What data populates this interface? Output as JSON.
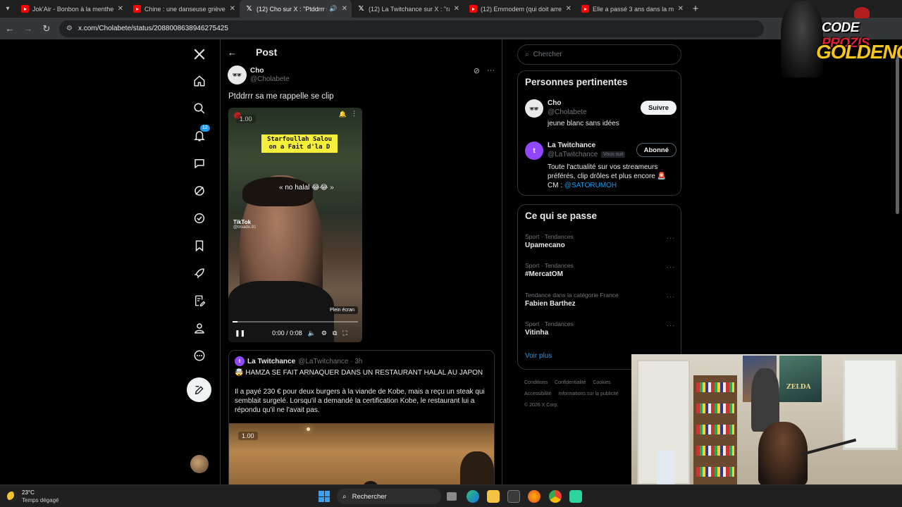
{
  "browser": {
    "tabs": [
      {
        "title": "Jok'Air - Bonbon à la menthe F",
        "type": "youtube",
        "active": false
      },
      {
        "title": "Chine : une danseuse grièveme",
        "type": "youtube",
        "active": false
      },
      {
        "title": "(12) Cho sur X : \"Ptddrrr sa",
        "type": "x",
        "active": true
      },
      {
        "title": "(12) La Twitchance sur X : \"ra Fl",
        "type": "x",
        "active": false
      },
      {
        "title": "(12) Emmodem (qui doit arrete",
        "type": "youtube",
        "active": false
      },
      {
        "title": "Elle a passé 3 ans dans la maiso",
        "type": "youtube",
        "active": false
      }
    ],
    "url": "x.com/Cholabete/status/2088008638946275425"
  },
  "nav": {
    "notification_badge": "12",
    "items": [
      "x-logo-icon",
      "home-icon",
      "search-icon",
      "bell-icon",
      "messages-icon",
      "grok-icon",
      "verified-icon",
      "bookmark-icon",
      "rocket-icon",
      "edit-list-icon",
      "profile-icon",
      "more-icon"
    ]
  },
  "post": {
    "header_title": "Post",
    "author_name": "Cho",
    "author_handle": "@Cholabete",
    "text": "Ptddrrr sa me rappelle se clip",
    "video": {
      "speed": "1.00",
      "caption": "Starfoullah Salou on a Fait d'la D",
      "overlay_text": "« no halal 😂😂 »",
      "tiktok_label": "TikTok",
      "tiktok_user": "@trisado.91",
      "fullscreen_tip": "Plein écran",
      "time": "0:00 / 0:08",
      "progress": 0.0
    },
    "quote": {
      "author_name": "La Twitchance",
      "author_handle": "@LaTwitchance · 3h",
      "title": "🤯 HAMZA SE FAIT ARNAQUER DANS UN RESTAURANT HALAL AU JAPON",
      "body": "Il a payé 230 € pour deux burgers à la viande de Kobe, mais a reçu un steak qui semblait surgelé. Lorsqu'il a demandé la certification Kobe, le restaurant lui a répondu qu'il ne l'avait pas.",
      "media_speed": "1.00"
    }
  },
  "sidebar": {
    "search_placeholder": "Chercher",
    "relevant": {
      "title": "Personnes pertinentes",
      "people": [
        {
          "name": "Cho",
          "handle": "@Cholabete",
          "bio": "jeune blanc sans idées",
          "button": "Suivre"
        },
        {
          "name": "La Twitchance",
          "handle": "@LaTwitchance",
          "follows_you": "Vous suit",
          "bio": "Toute l'actualité sur vos streameurs préférés, clip drôles et plus encore 🚨 CM : ",
          "bio_link": "@SATORUMOH",
          "button": "Abonné"
        }
      ]
    },
    "trends": {
      "title": "Ce qui se passe",
      "items": [
        {
          "meta": "Sport · Tendances",
          "name": "Upamecano"
        },
        {
          "meta": "Sport · Tendances",
          "name": "#MercatOM"
        },
        {
          "meta": "Tendance dans la catégorie France",
          "name": "Fabien Barthez"
        },
        {
          "meta": "Sport · Tendances",
          "name": "Vitinha"
        }
      ],
      "more": "Voir plus"
    },
    "footer": {
      "links": [
        "Conditions",
        "Confidentialité",
        "Cookies",
        "Accessibilité",
        "Informations sur la publicité"
      ],
      "copyright": "© 2026 X Corp."
    }
  },
  "overlay": {
    "logo_line1": "CODE",
    "logo_line1b": "PROZIS",
    "logo_line2": "GOLDENG",
    "poster_text": "ZELDA"
  },
  "taskbar": {
    "temperature": "23°C",
    "weather": "Temps dégagé",
    "search_label": "Rechercher"
  },
  "colors": {
    "accent": "#1d9bf0",
    "twitch": "#9146ff",
    "yellow_caption": "#f5ef3c"
  }
}
